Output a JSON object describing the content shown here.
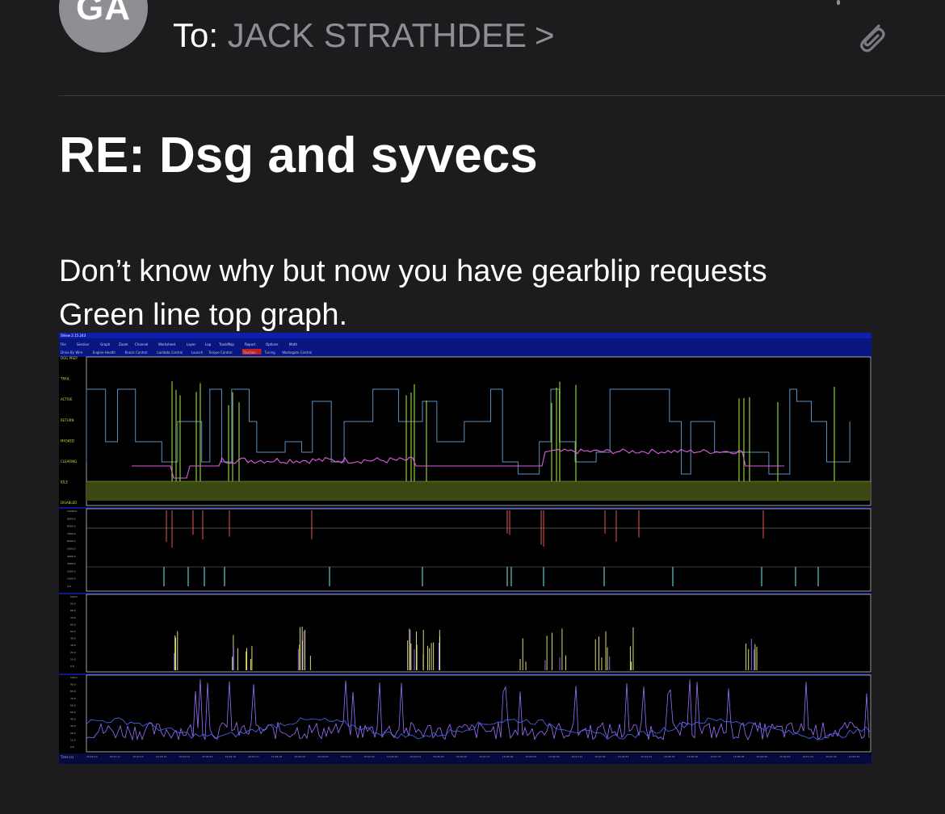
{
  "header": {
    "avatar_initials": "GA",
    "to_label": "To:",
    "recipient": "JACK STRATHDEE",
    "recipient_chevron": ">",
    "attachment_icon": "paperclip-icon"
  },
  "email": {
    "subject": "RE: Dsg and syvecs",
    "body_lines": [
      "Don’t know why but now you have gearblip requests",
      "Green line top graph."
    ]
  },
  "screenshot": {
    "window_title": "SView 2.15.243",
    "menu": [
      "File",
      "Session",
      "Graph",
      "Zoom",
      "Channel",
      "Worksheet",
      "Layer",
      "Lap",
      "TrackMap",
      "Report",
      "Options",
      "Math"
    ],
    "tabs": [
      "Drive By Wire",
      "Engine Health",
      "Knock Control",
      "Lambda Control",
      "Launch",
      "Torque Control",
      "Traction",
      "Tuning",
      "Wastegate Control"
    ],
    "active_tab": "Traction",
    "graph1_states": [
      "DOG PREP",
      "TRAIL",
      "ACTIVE",
      "RETURN",
      "MASKED",
      "CLEARING",
      "IDLE",
      "DISABLED"
    ],
    "graph2_ticks": [
      "10000.0",
      "9000.0",
      "8000.0",
      "7000.0",
      "6000.0",
      "5000.0",
      "4000.0",
      "3000.0",
      "2000.0",
      "1000.0",
      "0.0"
    ],
    "graph3_ticks": [
      "100.0",
      "90.0",
      "80.0",
      "70.0",
      "60.0",
      "50.0",
      "40.0",
      "30.0",
      "20.0",
      "10.0",
      "0.0"
    ],
    "graph4_ticks": [
      "100.0",
      "90.0",
      "80.0",
      "70.0",
      "60.0",
      "50.0",
      "40.0",
      "30.0",
      "20.0",
      "10.0",
      "0.0"
    ],
    "time_label": "Time (s)",
    "colors": {
      "bg": "#000000",
      "border": "#0a1a8a",
      "state_line": "#5a8fc0",
      "gearblip": "#9cdc3c",
      "magenta": "#e060e0",
      "rpm_red": "#ff6060",
      "rpm_cyan": "#80f0f0",
      "yellow": "#f0f080",
      "purple": "#9a70ff",
      "blue": "#4a6aff"
    }
  }
}
